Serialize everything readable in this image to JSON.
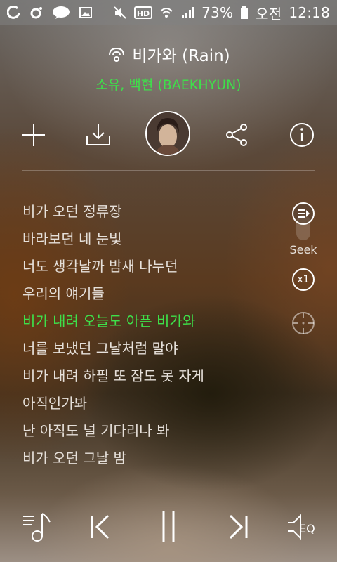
{
  "status_bar": {
    "battery": "73%",
    "ampm": "오전",
    "time": "12:18",
    "left_icons": [
      "g-icon",
      "o-icon",
      "talk-icon",
      "gallery-icon"
    ],
    "right_icons": [
      "mute-icon",
      "hd-icon",
      "wifi-icon",
      "signal-icon",
      "battery-icon"
    ],
    "talk_label": "TALK",
    "hd_label": "HD"
  },
  "song": {
    "title": "비가와 (Rain)",
    "artist": "소유, 백현 (BAEKHYUN)"
  },
  "colors": {
    "accent_green": "#3ee04a"
  },
  "actions": [
    "add-icon",
    "download-icon",
    "album-art",
    "share-icon",
    "info-icon"
  ],
  "lyrics": [
    {
      "text": "비가 오던 정류장",
      "current": false
    },
    {
      "text": "바라보던 네 눈빛",
      "current": false
    },
    {
      "text": "너도 생각날까 밤새 나누던",
      "current": false
    },
    {
      "text": "우리의 얘기들",
      "current": false
    },
    {
      "text": "비가 내려 오늘도 아픈 비가와",
      "current": true
    },
    {
      "text": "너를 보냈던 그날처럼 말야",
      "current": false
    },
    {
      "text": "비가 내려 하필 또 잠도 못 자게",
      "current": false
    },
    {
      "text": "아직인가봐",
      "current": false
    },
    {
      "text": "난 아직도 널 기다리나 봐",
      "current": false
    },
    {
      "text": "비가 오던 그날 밤",
      "current": false
    }
  ],
  "side_controls": {
    "seek_label": "Seek",
    "speed_label": "x1"
  },
  "bottom_bar": {
    "eq_label": "EQ"
  }
}
